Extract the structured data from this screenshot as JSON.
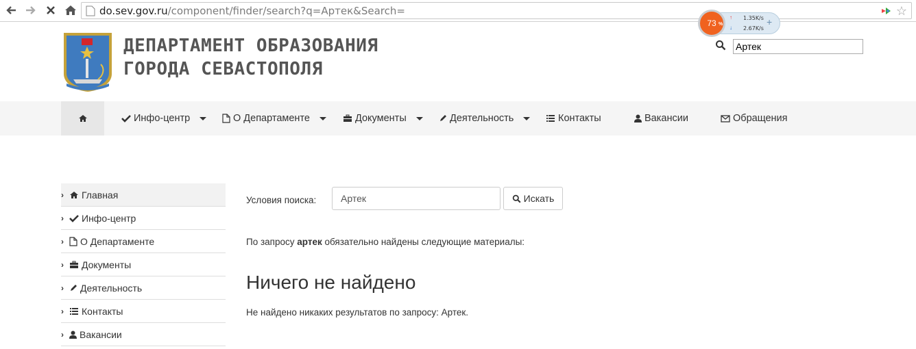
{
  "browser": {
    "url_host": "do.sev.gov.ru",
    "url_path": "/component/finder/search?q=Артек&Search="
  },
  "speed_widget": {
    "percent": "73",
    "pct_sign": "%",
    "upload": "1.35K/s",
    "download": "2.67K/s"
  },
  "header": {
    "title_line1": "ДЕПАРТАМЕНТ ОБРАЗОВАНИЯ",
    "title_line2": "ГОРОДА СЕВАСТОПОЛЯ",
    "search_value": "Артек"
  },
  "nav": {
    "items": [
      {
        "label": "Инфо-центр"
      },
      {
        "label": "О Департаменте"
      },
      {
        "label": "Документы"
      },
      {
        "label": "Деятельность"
      },
      {
        "label": "Контакты"
      },
      {
        "label": "Вакансии"
      },
      {
        "label": "Обращения"
      }
    ]
  },
  "sidebar": {
    "items": [
      {
        "label": "Главная"
      },
      {
        "label": "Инфо-центр"
      },
      {
        "label": "О Департаменте"
      },
      {
        "label": "Документы"
      },
      {
        "label": "Деятельность"
      },
      {
        "label": "Контакты"
      },
      {
        "label": "Вакансии"
      }
    ]
  },
  "search": {
    "label": "Условия поиска:",
    "value": "Артек",
    "button_label": "Искать"
  },
  "results": {
    "prefix": "По запросу ",
    "query": "артек",
    "suffix": " обязательно найдены следующие материалы:",
    "heading": "Ничего не найдено",
    "message": "Не найдено никаких результатов по запросу: Артек."
  },
  "colors": {
    "navbar_bg": "#f5f5f5",
    "widget_orange": "#f0621f"
  }
}
